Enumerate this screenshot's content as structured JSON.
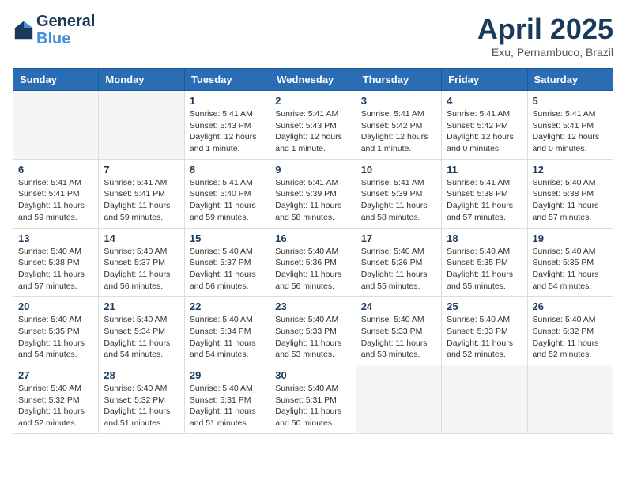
{
  "header": {
    "logo_line1": "General",
    "logo_line2": "Blue",
    "month_title": "April 2025",
    "subtitle": "Exu, Pernambuco, Brazil"
  },
  "columns": [
    "Sunday",
    "Monday",
    "Tuesday",
    "Wednesday",
    "Thursday",
    "Friday",
    "Saturday"
  ],
  "weeks": [
    [
      {
        "day": "",
        "info": ""
      },
      {
        "day": "",
        "info": ""
      },
      {
        "day": "1",
        "info": "Sunrise: 5:41 AM\nSunset: 5:43 PM\nDaylight: 12 hours\nand 1 minute."
      },
      {
        "day": "2",
        "info": "Sunrise: 5:41 AM\nSunset: 5:43 PM\nDaylight: 12 hours\nand 1 minute."
      },
      {
        "day": "3",
        "info": "Sunrise: 5:41 AM\nSunset: 5:42 PM\nDaylight: 12 hours\nand 1 minute."
      },
      {
        "day": "4",
        "info": "Sunrise: 5:41 AM\nSunset: 5:42 PM\nDaylight: 12 hours\nand 0 minutes."
      },
      {
        "day": "5",
        "info": "Sunrise: 5:41 AM\nSunset: 5:41 PM\nDaylight: 12 hours\nand 0 minutes."
      }
    ],
    [
      {
        "day": "6",
        "info": "Sunrise: 5:41 AM\nSunset: 5:41 PM\nDaylight: 11 hours\nand 59 minutes."
      },
      {
        "day": "7",
        "info": "Sunrise: 5:41 AM\nSunset: 5:41 PM\nDaylight: 11 hours\nand 59 minutes."
      },
      {
        "day": "8",
        "info": "Sunrise: 5:41 AM\nSunset: 5:40 PM\nDaylight: 11 hours\nand 59 minutes."
      },
      {
        "day": "9",
        "info": "Sunrise: 5:41 AM\nSunset: 5:39 PM\nDaylight: 11 hours\nand 58 minutes."
      },
      {
        "day": "10",
        "info": "Sunrise: 5:41 AM\nSunset: 5:39 PM\nDaylight: 11 hours\nand 58 minutes."
      },
      {
        "day": "11",
        "info": "Sunrise: 5:41 AM\nSunset: 5:38 PM\nDaylight: 11 hours\nand 57 minutes."
      },
      {
        "day": "12",
        "info": "Sunrise: 5:40 AM\nSunset: 5:38 PM\nDaylight: 11 hours\nand 57 minutes."
      }
    ],
    [
      {
        "day": "13",
        "info": "Sunrise: 5:40 AM\nSunset: 5:38 PM\nDaylight: 11 hours\nand 57 minutes."
      },
      {
        "day": "14",
        "info": "Sunrise: 5:40 AM\nSunset: 5:37 PM\nDaylight: 11 hours\nand 56 minutes."
      },
      {
        "day": "15",
        "info": "Sunrise: 5:40 AM\nSunset: 5:37 PM\nDaylight: 11 hours\nand 56 minutes."
      },
      {
        "day": "16",
        "info": "Sunrise: 5:40 AM\nSunset: 5:36 PM\nDaylight: 11 hours\nand 56 minutes."
      },
      {
        "day": "17",
        "info": "Sunrise: 5:40 AM\nSunset: 5:36 PM\nDaylight: 11 hours\nand 55 minutes."
      },
      {
        "day": "18",
        "info": "Sunrise: 5:40 AM\nSunset: 5:35 PM\nDaylight: 11 hours\nand 55 minutes."
      },
      {
        "day": "19",
        "info": "Sunrise: 5:40 AM\nSunset: 5:35 PM\nDaylight: 11 hours\nand 54 minutes."
      }
    ],
    [
      {
        "day": "20",
        "info": "Sunrise: 5:40 AM\nSunset: 5:35 PM\nDaylight: 11 hours\nand 54 minutes."
      },
      {
        "day": "21",
        "info": "Sunrise: 5:40 AM\nSunset: 5:34 PM\nDaylight: 11 hours\nand 54 minutes."
      },
      {
        "day": "22",
        "info": "Sunrise: 5:40 AM\nSunset: 5:34 PM\nDaylight: 11 hours\nand 54 minutes."
      },
      {
        "day": "23",
        "info": "Sunrise: 5:40 AM\nSunset: 5:33 PM\nDaylight: 11 hours\nand 53 minutes."
      },
      {
        "day": "24",
        "info": "Sunrise: 5:40 AM\nSunset: 5:33 PM\nDaylight: 11 hours\nand 53 minutes."
      },
      {
        "day": "25",
        "info": "Sunrise: 5:40 AM\nSunset: 5:33 PM\nDaylight: 11 hours\nand 52 minutes."
      },
      {
        "day": "26",
        "info": "Sunrise: 5:40 AM\nSunset: 5:32 PM\nDaylight: 11 hours\nand 52 minutes."
      }
    ],
    [
      {
        "day": "27",
        "info": "Sunrise: 5:40 AM\nSunset: 5:32 PM\nDaylight: 11 hours\nand 52 minutes."
      },
      {
        "day": "28",
        "info": "Sunrise: 5:40 AM\nSunset: 5:32 PM\nDaylight: 11 hours\nand 51 minutes."
      },
      {
        "day": "29",
        "info": "Sunrise: 5:40 AM\nSunset: 5:31 PM\nDaylight: 11 hours\nand 51 minutes."
      },
      {
        "day": "30",
        "info": "Sunrise: 5:40 AM\nSunset: 5:31 PM\nDaylight: 11 hours\nand 50 minutes."
      },
      {
        "day": "",
        "info": ""
      },
      {
        "day": "",
        "info": ""
      },
      {
        "day": "",
        "info": ""
      }
    ]
  ]
}
